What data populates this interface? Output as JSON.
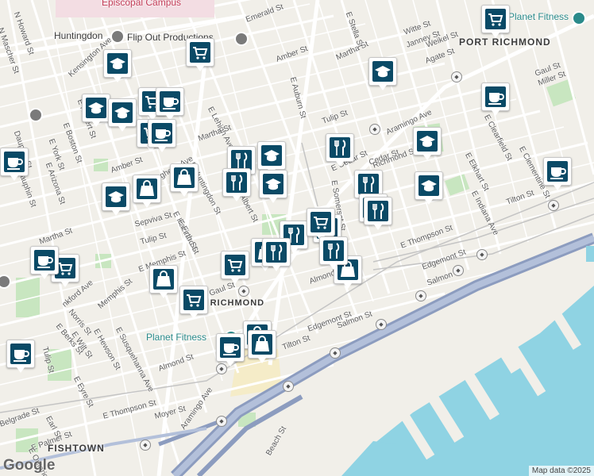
{
  "map": {
    "colors": {
      "land": "#f1efe9",
      "water": "#8fd3e3",
      "park": "#c8e6c0",
      "highway": "#9aa9c6",
      "road": "#ffffff",
      "marker": "#0a4a66"
    },
    "areas": [
      "PORT RICHMOND",
      "OLDE RICHMOND",
      "FISHTOWN"
    ],
    "pois": [
      "Huntingdon",
      "Flip Out Productions",
      "Episcopal Campus",
      "Planet Fitness",
      "Planet Fitness"
    ],
    "streets": [
      "Emerald St",
      "Amber St",
      "E Auburn St",
      "Martha St",
      "Witte St",
      "Janney St",
      "Weikel St",
      "Agate St",
      "Gaul St",
      "Miller St",
      "Kensington Ave",
      "E Hagert St",
      "E Boston St",
      "E York St",
      "E Dauphin St",
      "E Arizona St",
      "Amber St",
      "Martha St",
      "E Lehigh Ave",
      "Martha St",
      "E Huntingdon St",
      "E Hazzard St",
      "E Firth St",
      "Sepviva St",
      "Tulip St",
      "E Memphis St",
      "Albert St",
      "Tulip St",
      "E Cedar St",
      "Aramingo Ave",
      "E Somerset St",
      "Cedar St",
      "Almond St",
      "E Thompson St",
      "Edgemont St",
      "Salmon St",
      "E Elkhart St",
      "E Indiana Ave",
      "Tilton St",
      "E Clementine St",
      "Richmond St",
      "Gaul St",
      "Memphis St",
      "Norris St",
      "E Berks St",
      "E Wilt St",
      "E Hewson St",
      "E Susquehanna Ave",
      "Almond St",
      "Edgemont St",
      "Salmon St",
      "Tilton St",
      "Aramingo Ave",
      "E Thompson St",
      "Moyer St",
      "E Palmer St",
      "E Eyre St",
      "Earl St",
      "Belgrade St",
      "Beach St",
      "Tulip St",
      "nkford Ave",
      "N Mascher St",
      "N Howard St",
      "Dauphin St",
      "E Stella St",
      "E Clearfield St",
      "E Ontario St",
      "E Allegheny Ave"
    ],
    "attribution": "Map data ©2025",
    "logo_text": "Google",
    "markers": [
      {
        "icon": "shopping-cart-icon"
      },
      {
        "icon": "graduation-cap-icon"
      },
      {
        "icon": "shopping-cart-icon"
      },
      {
        "icon": "graduation-cap-icon"
      },
      {
        "icon": "graduation-cap-icon"
      },
      {
        "icon": "coffee-cup-icon"
      },
      {
        "icon": "shopping-cart-icon"
      },
      {
        "icon": "coffee-cup-icon"
      },
      {
        "icon": "coffee-cup-icon"
      },
      {
        "icon": "shopping-bag-icon"
      },
      {
        "icon": "restaurant-icon"
      },
      {
        "icon": "graduation-cap-icon"
      },
      {
        "icon": "restaurant-icon"
      },
      {
        "icon": "graduation-cap-icon"
      },
      {
        "icon": "graduation-cap-icon"
      },
      {
        "icon": "shopping-bag-icon"
      },
      {
        "icon": "restaurant-icon"
      },
      {
        "icon": "graduation-cap-icon"
      },
      {
        "icon": "restaurant-icon"
      },
      {
        "icon": "restaurant-icon"
      },
      {
        "icon": "restaurant-icon"
      },
      {
        "icon": "restaurant-icon"
      },
      {
        "icon": "restaurant-icon"
      },
      {
        "icon": "shopping-bag-icon"
      },
      {
        "icon": "shopping-cart-icon"
      },
      {
        "icon": "shopping-bag-icon"
      },
      {
        "icon": "shopping-bag-icon"
      },
      {
        "icon": "shopping-cart-icon"
      },
      {
        "icon": "shopping-cart-icon"
      },
      {
        "icon": "coffee-cup-icon"
      },
      {
        "icon": "shopping-bag-icon"
      },
      {
        "icon": "coffee-cup-icon"
      },
      {
        "icon": "coffee-cup-icon"
      },
      {
        "icon": "shopping-cart-icon"
      },
      {
        "icon": "coffee-cup-icon"
      },
      {
        "icon": "graduation-cap-icon"
      },
      {
        "icon": "graduation-cap-icon"
      },
      {
        "icon": "restaurant-icon"
      },
      {
        "icon": "restaurant-icon"
      },
      {
        "icon": "shopping-cart-icon"
      },
      {
        "icon": "coffee-cup-icon"
      },
      {
        "icon": "shopping-bag-icon"
      }
    ]
  }
}
